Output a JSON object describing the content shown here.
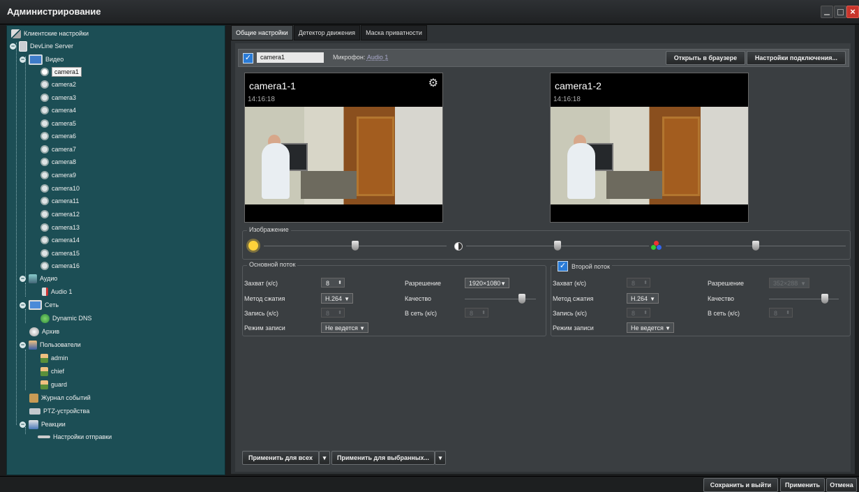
{
  "window": {
    "title": "Администрирование"
  },
  "tree": {
    "client_settings": "Клиентские настройки",
    "server": "DevLine Server",
    "video": "Видео",
    "cameras": [
      "camera1",
      "camera2",
      "camera3",
      "camera4",
      "camera5",
      "camera6",
      "camera7",
      "camera8",
      "camera9",
      "camera10",
      "camera11",
      "camera12",
      "camera13",
      "camera14",
      "camera15",
      "camera16"
    ],
    "audio": "Аудио",
    "audio1": "Audio 1",
    "network": "Сеть",
    "dyndns": "Dynamic DNS",
    "archive": "Архив",
    "users": "Пользователи",
    "user_list": [
      "admin",
      "chief",
      "guard"
    ],
    "event_log": "Журнал событий",
    "ptz": "PTZ-устройства",
    "reactions": "Реакции",
    "send_settings": "Настройки отправки"
  },
  "tabs": [
    "Общие настройки",
    "Детектор движения",
    "Маска приватности"
  ],
  "camera_row": {
    "name": "camera1",
    "mic_label": "Микрофон:",
    "mic_value": "Audio 1",
    "open_browser": "Открыть в браузере",
    "conn_settings": "Настройки подключения..."
  },
  "previews": [
    {
      "title": "camera1-1",
      "timestamp": "14:16:18"
    },
    {
      "title": "camera1-2",
      "timestamp": "14:16:18"
    }
  ],
  "image_group": {
    "label": "Изображение",
    "brightness": 0.5,
    "contrast": 0.5,
    "saturation": 0.5
  },
  "main_stream": {
    "label": "Основной поток",
    "capture_label": "Захват (к/с)",
    "capture_value": "8",
    "resolution_label": "Разрешение",
    "resolution_value": "1920×1080",
    "codec_label": "Метод сжатия",
    "codec_value": "H.264",
    "quality_label": "Качество",
    "quality": 0.8,
    "record_label": "Запись (к/с)",
    "record_value": "8",
    "net_label": "В сеть (к/с)",
    "net_value": "8",
    "mode_label": "Режим записи",
    "mode_value": "Не ведется"
  },
  "second_stream": {
    "label": "Второй поток",
    "capture_label": "Захват (к/с)",
    "capture_value": "8",
    "resolution_label": "Разрешение",
    "resolution_value": "352×288",
    "codec_label": "Метод сжатия",
    "codec_value": "H.264",
    "quality_label": "Качество",
    "quality": 0.8,
    "record_label": "Запись (к/с)",
    "record_value": "8",
    "net_label": "В сеть (к/с)",
    "net_value": "8",
    "mode_label": "Режим записи",
    "mode_value": "Не ведется"
  },
  "apply_all": "Применить для всех",
  "apply_selected": "Применить для выбранных...",
  "bottom": {
    "save_exit": "Сохранить и выйти",
    "apply": "Применить",
    "cancel": "Отмена"
  }
}
